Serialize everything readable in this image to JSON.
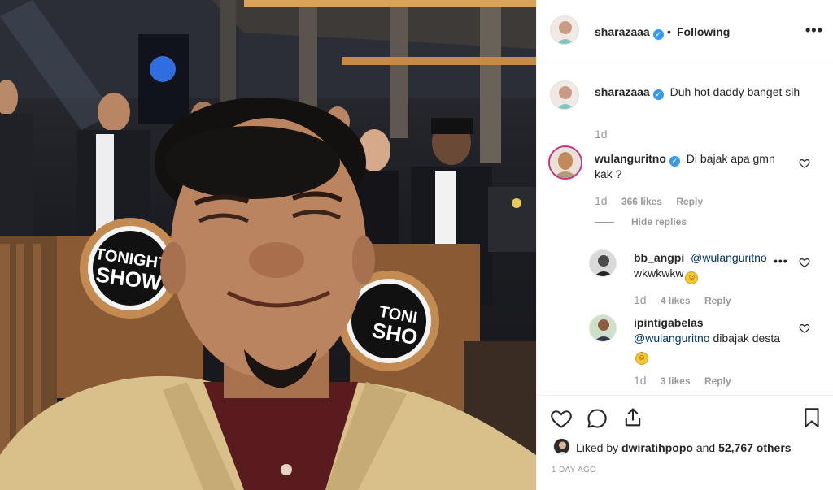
{
  "photo": {
    "alt": "selfie photo",
    "sign_text": [
      "TONIGHT",
      "SHOW"
    ],
    "sign_text_right": [
      "TONI",
      "SHO"
    ]
  },
  "header": {
    "username": "sharazaaa",
    "separator": "•",
    "follow_status": "Following",
    "more_label": "•••"
  },
  "caption": {
    "username": "sharazaaa",
    "text": "Duh hot daddy banget sih",
    "time": "1d"
  },
  "comments": [
    {
      "username": "wulanguritno",
      "text": "Di bajak apa gmn kak ?",
      "time": "1d",
      "likes": "366 likes",
      "reply_label": "Reply",
      "hide_replies": "Hide replies"
    }
  ],
  "replies": [
    {
      "username": "bb_angpi",
      "mention": "@wulanguritno",
      "text": "wkwkwkw",
      "time": "1d",
      "likes": "4 likes",
      "reply_label": "Reply",
      "more_label": "•••"
    },
    {
      "username": "ipintigabelas",
      "mention": "@wulanguritno",
      "text": "dibajak desta",
      "time": "1d",
      "likes": "3 likes",
      "reply_label": "Reply"
    }
  ],
  "footer": {
    "liked_by_prefix": "Liked by",
    "liked_by_user": "dwiratihpopo",
    "liked_by_and": "and",
    "liked_by_others": "52,767 others",
    "date": "1 DAY AGO"
  },
  "icons": {
    "emoji_symbol": "☺"
  },
  "colors": {
    "verified": "#3897f0",
    "mention": "#003569",
    "muted": "#999999",
    "border": "#efefef"
  }
}
